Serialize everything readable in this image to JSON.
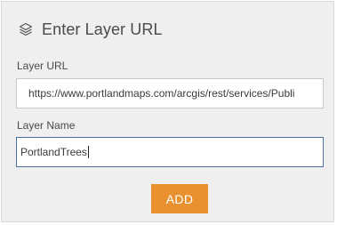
{
  "header": {
    "title": "Enter Layer URL",
    "icon": "layers-icon"
  },
  "form": {
    "url_label": "Layer URL",
    "url_value": "https://www.portlandmaps.com/arcgis/rest/services/Publi",
    "name_label": "Layer Name",
    "name_value": "PortlandTrees",
    "add_label": "ADD"
  },
  "colors": {
    "accent_button": "#ea912f",
    "focus_border": "#4a6fa5",
    "panel_bg": "#efefef"
  }
}
